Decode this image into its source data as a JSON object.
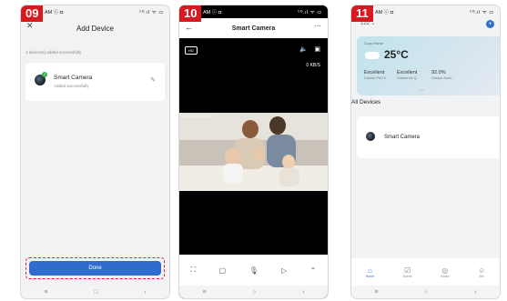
{
  "phone1": {
    "step": "09",
    "status_time": "AM ⓒ ◘",
    "status_icons": "⁵ᴳ.ıl ᯤ ▭",
    "title": "Add Device",
    "close_icon": "close-icon",
    "subtitle": "1 device(s) added successfully",
    "device_name": "Smart Camera",
    "device_status": "Added successfully",
    "done_label": "Done",
    "nav": [
      "≡",
      "□",
      "‹"
    ]
  },
  "phone2": {
    "step": "10",
    "status_time": "AM ⓒ ◘",
    "status_icons": "⁵ᴳ.ıl ᯤ ▭",
    "title": "Smart Camera",
    "hd_label": "HD",
    "speed": "0 KB/S",
    "timestamp": "2023-09-07 10:44:57",
    "nav": [
      "≡",
      "○",
      "‹"
    ]
  },
  "phone3": {
    "step": "11",
    "status_time": "AM ⓒ ◘",
    "status_icons": "⁵ᴳ.ıl ᯤ ▭",
    "home_selector": "122 ⌄",
    "weather_label": "Cozy Home",
    "temperature": "25°C",
    "metrics": [
      {
        "value": "Excellent",
        "label": "Outdoor PM2.5"
      },
      {
        "value": "Excellent",
        "label": "Outdoor Air Q..."
      },
      {
        "value": "92.0%",
        "label": "Outdoor Humi..."
      }
    ],
    "section": "All Devices",
    "device_name": "Smart Camera",
    "tabs": [
      {
        "label": "Home",
        "icon": "home-icon"
      },
      {
        "label": "Scene",
        "icon": "scene-icon"
      },
      {
        "label": "Smart",
        "icon": "smart-icon"
      },
      {
        "label": "Me",
        "icon": "me-icon"
      }
    ],
    "nav": [
      "≡",
      "○",
      "‹"
    ]
  },
  "colors": {
    "accent": "#2f6ccd",
    "step_badge": "#d71920",
    "highlight": "#e0202a"
  }
}
